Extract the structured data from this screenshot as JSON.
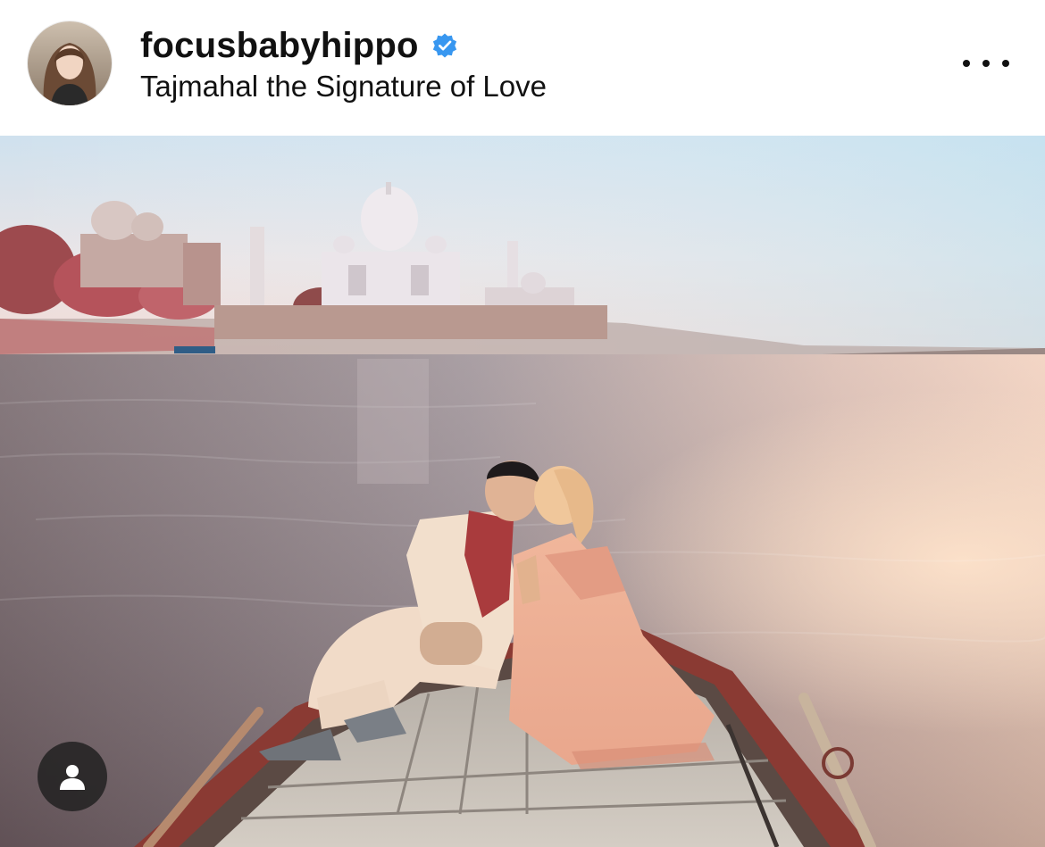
{
  "post": {
    "username": "focusbabyhippo",
    "caption": "Tajmahal the Signature of Love",
    "verified": true,
    "verified_color": "#3897f0",
    "avatar_icon": "profile-photo",
    "more_icon": "more-horizontal-icon",
    "tag_icon": "user-tag-icon"
  }
}
